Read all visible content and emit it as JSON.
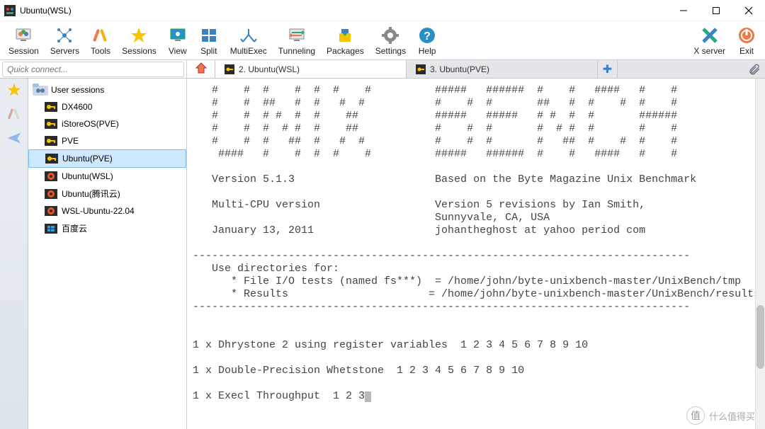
{
  "window": {
    "title": "Ubuntu(WSL)"
  },
  "toolbar": [
    {
      "name": "session",
      "label": "Session"
    },
    {
      "name": "servers",
      "label": "Servers"
    },
    {
      "name": "tools",
      "label": "Tools"
    },
    {
      "name": "sessions",
      "label": "Sessions"
    },
    {
      "name": "view",
      "label": "View"
    },
    {
      "name": "split",
      "label": "Split"
    },
    {
      "name": "multiexec",
      "label": "MultiExec"
    },
    {
      "name": "tunneling",
      "label": "Tunneling"
    },
    {
      "name": "packages",
      "label": "Packages"
    },
    {
      "name": "settings",
      "label": "Settings"
    },
    {
      "name": "help",
      "label": "Help"
    }
  ],
  "toolbar_right": [
    {
      "name": "xserver",
      "label": "X server"
    },
    {
      "name": "exit",
      "label": "Exit"
    }
  ],
  "quick_connect": {
    "placeholder": "Quick connect..."
  },
  "tabs": {
    "tab2": "2. Ubuntu(WSL)",
    "tab3": "3. Ubuntu(PVE)"
  },
  "tree": {
    "root": "User sessions",
    "items": [
      {
        "label": "DX4600",
        "type": "key"
      },
      {
        "label": "iStoreOS(PVE)",
        "type": "key"
      },
      {
        "label": "PVE",
        "type": "key"
      },
      {
        "label": "Ubuntu(PVE)",
        "type": "key",
        "selected": true
      },
      {
        "label": "Ubuntu(WSL)",
        "type": "linux"
      },
      {
        "label": "Ubuntu(腾讯云)",
        "type": "linux"
      },
      {
        "label": "WSL-Ubuntu-22.04",
        "type": "linux"
      },
      {
        "label": "百度云",
        "type": "win"
      }
    ]
  },
  "terminal_text": "   #    #  #    #  #  #    #          #####   ######  #    #   ####   #    #\n   #    #  ##   #  #   #  #           #    #  #       ##   #  #    #  #    #\n   #    #  # #  #  #    ##            #####   #####   # #  #  #       ######\n   #    #  #  # #  #    ##            #    #  #       #  # #  #       #    #\n   #    #  #   ##  #   #  #           #    #  #       #   ##  #    #  #    #\n    ####   #    #  #  #    #          #####   ######  #    #   ####   #    #\n\n   Version 5.1.3                      Based on the Byte Magazine Unix Benchmark\n\n   Multi-CPU version                  Version 5 revisions by Ian Smith,\n                                      Sunnyvale, CA, USA\n   January 13, 2011                   johantheghost at yahoo period com\n\n------------------------------------------------------------------------------\n   Use directories for:\n      * File I/O tests (named fs***)  = /home/john/byte-unixbench-master/UnixBench/tmp\n      * Results                      = /home/john/byte-unixbench-master/UnixBench/results\n------------------------------------------------------------------------------\n\n\n1 x Dhrystone 2 using register variables  1 2 3 4 5 6 7 8 9 10\n\n1 x Double-Precision Whetstone  1 2 3 4 5 6 7 8 9 10\n\n1 x Execl Throughput  1 2 3",
  "watermark": {
    "text": "什么值得买"
  }
}
